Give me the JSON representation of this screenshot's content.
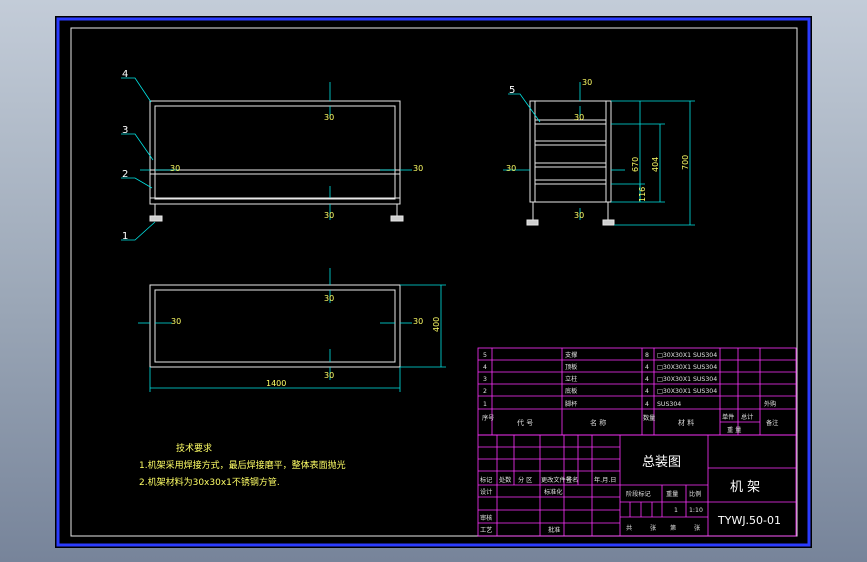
{
  "balloons": [
    "4",
    "3",
    "2",
    "1",
    "5"
  ],
  "front_view": {
    "dims": [
      "30",
      "30",
      "30",
      "30",
      "30"
    ]
  },
  "side_view": {
    "dims": [
      "30",
      "30",
      "30",
      "30",
      "404",
      "670",
      "700",
      "116"
    ]
  },
  "top_view": {
    "dims": [
      "30",
      "30",
      "30",
      "30",
      "30",
      "400",
      "1400"
    ]
  },
  "requirements": {
    "title": "技术要求",
    "line1": "1.机架采用焊接方式，最后焊接磨平，整体表面抛光",
    "line2": "2.机架材料为30x30x1不锈钢方管."
  },
  "bom": {
    "rows": [
      {
        "no": "5",
        "name": "支撑",
        "qty": "8",
        "material": "□30X30X1 SUS304"
      },
      {
        "no": "4",
        "name": "顶板",
        "qty": "4",
        "material": "□30X30X1 SUS304"
      },
      {
        "no": "3",
        "name": "立柱",
        "qty": "4",
        "material": "□30X30X1 SUS304"
      },
      {
        "no": "2",
        "name": "底板",
        "qty": "4",
        "material": "□30X30X1 SUS304"
      },
      {
        "no": "1",
        "name": "脚杯",
        "qty": "4",
        "material": "SUS304"
      }
    ],
    "outsourced": "外购",
    "header": {
      "no": "序号",
      "code": "代 号",
      "name": "名 称",
      "qty": "数量",
      "material": "材 料",
      "single": "单件",
      "total": "总计",
      "weight": "重 量",
      "remark": "备注"
    }
  },
  "title_block": {
    "drawing_title": "总装图",
    "part_name": "机 架",
    "drawing_no": "TYWJ.50-01",
    "scale_value": "1:10",
    "mark_count": "1",
    "rev_header": [
      "标记",
      "处数",
      "分 区",
      "更改文件号",
      "签名",
      "年.月.日"
    ],
    "design": "设计",
    "standardize": "标准化",
    "review": "审核",
    "process": "工艺",
    "approve": "批准",
    "stage": "阶段标记",
    "weight": "重量",
    "scale": "比例",
    "sheets": [
      "共",
      "张",
      "第",
      "张"
    ]
  }
}
